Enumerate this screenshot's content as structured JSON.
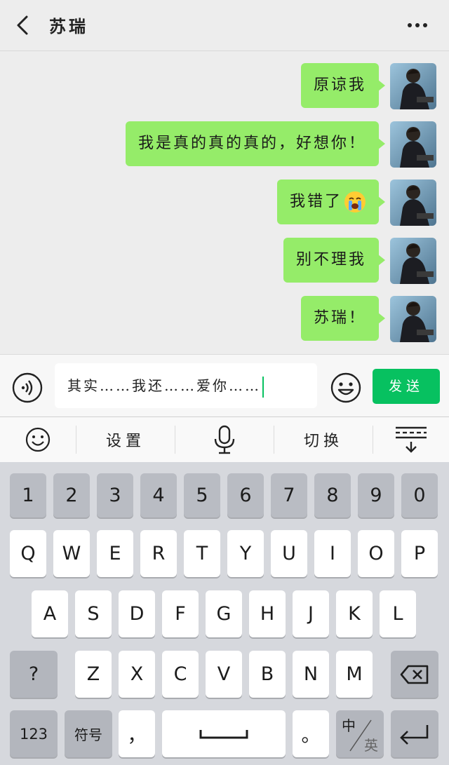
{
  "header": {
    "title": "苏瑞",
    "back_icon": "chevron-left-icon",
    "more_icon": "more-dots-icon"
  },
  "messages": [
    {
      "text": "原谅我"
    },
    {
      "text": "我是真的真的真的，好想你！"
    },
    {
      "text": "我错了",
      "emoji": "crying-face-emoji"
    },
    {
      "text": "别不理我"
    },
    {
      "text": "苏瑞！"
    }
  ],
  "input": {
    "value": "其实……我还……爱你……",
    "send_label": "发送"
  },
  "toolbar": {
    "settings_label": "设置",
    "switch_label": "切换"
  },
  "keyboard": {
    "number_row": [
      "1",
      "2",
      "3",
      "4",
      "5",
      "6",
      "7",
      "8",
      "9",
      "0"
    ],
    "row1": [
      "Q",
      "W",
      "E",
      "R",
      "T",
      "Y",
      "U",
      "I",
      "O",
      "P"
    ],
    "row2": [
      "A",
      "S",
      "D",
      "F",
      "G",
      "H",
      "J",
      "K",
      "L"
    ],
    "row3": [
      "Z",
      "X",
      "C",
      "V",
      "B",
      "N",
      "M"
    ],
    "question_key": "?",
    "num_mode_key": "123",
    "symbol_key": "符号",
    "comma_key": "，",
    "period_key": "。",
    "lang_cn": "中",
    "lang_en": "英"
  },
  "colors": {
    "bubble": "#95ec69",
    "send": "#07c160",
    "background": "#ededed"
  }
}
